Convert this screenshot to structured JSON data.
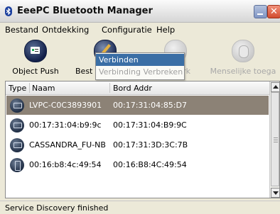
{
  "window": {
    "title": "EeePC Bluetooth Manager"
  },
  "menubar": {
    "items": [
      "Bestand",
      "Ontdekking",
      "Configuratie",
      "Help"
    ]
  },
  "toolbar": {
    "buttons": [
      {
        "label": "Object Push",
        "icon": "object-push-icon",
        "enabled": true
      },
      {
        "label": "Best",
        "icon": "wrench-icon",
        "enabled": true
      },
      {
        "label": "erk",
        "icon": "network-icon",
        "enabled": false
      },
      {
        "label": "Menselijke toega",
        "icon": "input-device-icon",
        "enabled": false
      }
    ]
  },
  "dropdown": {
    "items": [
      {
        "label": "Verbinden",
        "state": "highlighted"
      },
      {
        "label": "Verbinding Verbreken",
        "state": "disabled"
      }
    ]
  },
  "devices": {
    "columns": [
      "Type",
      "Naam",
      "Bord Addr"
    ],
    "rows": [
      {
        "type": "computer-icon",
        "name": "LVPC-C0C3893901",
        "addr": "00:17:31:04:85:D7",
        "selected": true
      },
      {
        "type": "computer-icon",
        "name": "00:17:31:04:b9:9c",
        "addr": "00:17:31:04:B9:9C",
        "selected": false
      },
      {
        "type": "computer-icon",
        "name": "CASSANDRA_FU-NB",
        "addr": "00:17:31:3D:3C:7B",
        "selected": false
      },
      {
        "type": "phone-icon",
        "name": "00:16:b8:4c:49:54",
        "addr": "00:16:B8:4C:49:54",
        "selected": false
      }
    ]
  },
  "statusbar": {
    "text": "Service Discovery finished"
  },
  "colors": {
    "selection": "#8c8276",
    "menu_highlight": "#3a6ea5",
    "icon_dark": "#1f2d44"
  }
}
